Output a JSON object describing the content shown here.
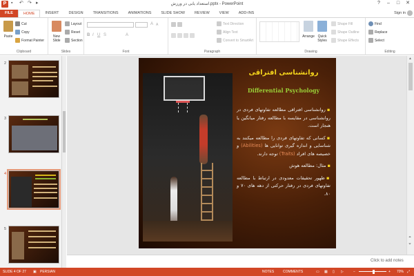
{
  "window": {
    "title": "استعداد یابی در ورزش.pptx - PowerPoint",
    "controls": [
      "?",
      "–",
      "□",
      "✕"
    ]
  },
  "qat": [
    "save-icon",
    "undo-icon",
    "redo-icon",
    "present-icon"
  ],
  "tabs": [
    {
      "label": "FILE"
    },
    {
      "label": "HOME"
    },
    {
      "label": "INSERT"
    },
    {
      "label": "DESIGN"
    },
    {
      "label": "TRANSITIONS"
    },
    {
      "label": "ANIMATIONS"
    },
    {
      "label": "SLIDE SHOW"
    },
    {
      "label": "REVIEW"
    },
    {
      "label": "VIEW"
    },
    {
      "label": "ADD-INS"
    }
  ],
  "signin": "Sign in",
  "ribbon": {
    "clipboard": {
      "paste": "Paste",
      "cut": "Cut",
      "copy": "Copy",
      "format_painter": "Format Painter",
      "label": "Clipboard"
    },
    "slides": {
      "new_slide": "New Slide",
      "layout": "Layout",
      "reset": "Reset",
      "section": "Section",
      "label": "Slides"
    },
    "font": {
      "label": "Font"
    },
    "paragraph": {
      "text_direction": "Text Direction",
      "align_text": "Align Text",
      "convert_smartart": "Convert to SmartArt",
      "label": "Paragraph"
    },
    "drawing": {
      "arrange": "Arrange",
      "quick_styles": "Quick Styles",
      "shape_fill": "Shape Fill",
      "shape_outline": "Shape Outline",
      "shape_effects": "Shape Effects",
      "label": "Drawing"
    },
    "editing": {
      "find": "Find",
      "replace": "Replace",
      "select": "Select",
      "label": "Editing"
    }
  },
  "thumbnails": [
    {
      "number": "2"
    },
    {
      "number": "3"
    },
    {
      "number": "4"
    },
    {
      "number": "5"
    }
  ],
  "slide": {
    "title": "روانشناسی افتراقی",
    "subtitle": "Differential Psychology",
    "bullet1": "روانشناسی افتراقی مطالعه تفاوتهای فردی در روانشناسی در مقایسه با مطالعه رفتار میانگین یا هنجار است.",
    "bullet2_a": "کسانی که تفاوتهای فردی را مطالعه میکنند به شناسایی و اندازه گیری توانایی ها",
    "bullet2_abilities": "(Abilities)",
    "bullet2_b": "و خصیصه های افراد",
    "bullet2_traits": "(Traits)",
    "bullet2_c": "توجه دارند.",
    "bullet3": "مثال: مطالعه هوش",
    "bullet4": "ظهور تحقیقات معدودی در ارتباط با مطالعه تفاوتهای فردی در رفتار حرکتی از دهه های ۷۰ و ۸۰."
  },
  "notes_placeholder": "Click to add notes",
  "status": {
    "slide_of": "SLIDE 4 OF 27",
    "language": "PERSIAN",
    "notes": "NOTES",
    "comments": "COMMENTS",
    "zoom": "70%"
  },
  "colors": {
    "accent": "#d24726",
    "title": "#f3d31c",
    "subtitle": "#9bd238"
  }
}
